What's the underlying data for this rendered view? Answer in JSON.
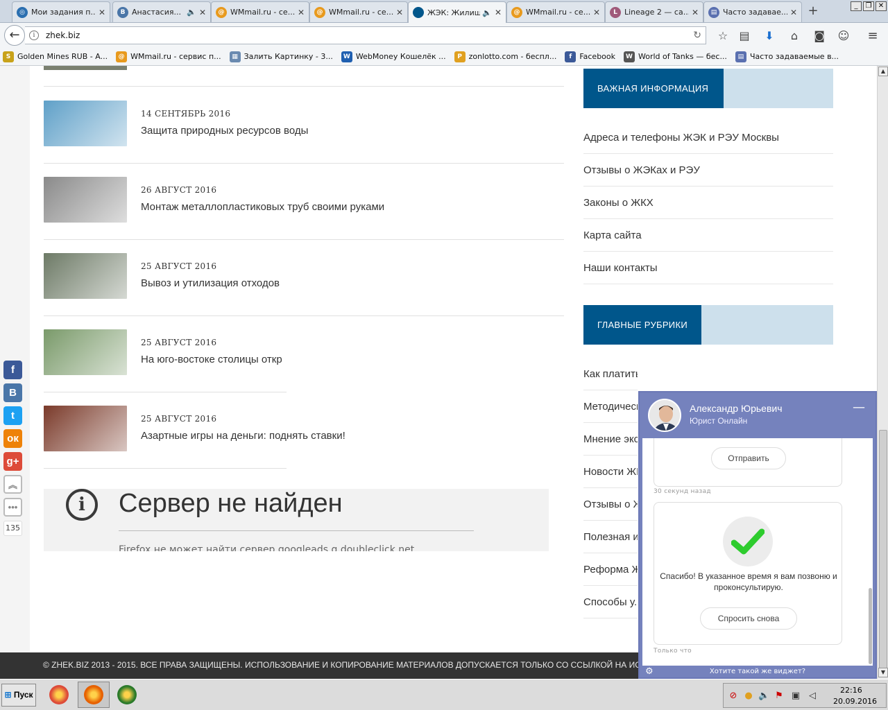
{
  "browser": {
    "tabs": [
      {
        "title": "Мои задания п...",
        "icon_color": "#2b6fb0",
        "icon_glyph": "◎"
      },
      {
        "title": "Анастасия...",
        "icon_color": "#4a76a8",
        "icon_glyph": "B",
        "sound": true
      },
      {
        "title": "WMmail.ru - се...",
        "icon_color": "#e89a1e",
        "icon_glyph": "@"
      },
      {
        "title": "WMmail.ru - се...",
        "icon_color": "#e89a1e",
        "icon_glyph": "@"
      },
      {
        "title": "ЖЭК: Жилищн...",
        "icon_color": "#00568b",
        "icon_glyph": "",
        "sound": true,
        "active": true
      },
      {
        "title": "WMmail.ru - се...",
        "icon_color": "#e89a1e",
        "icon_glyph": "@"
      },
      {
        "title": "Lineage 2 — са...",
        "icon_color": "#a05a7a",
        "icon_glyph": "L"
      },
      {
        "title": "Часто задавае...",
        "icon_color": "#5a70b0",
        "icon_glyph": "▤"
      }
    ],
    "url": "zhek.biz",
    "bookmarks": [
      {
        "label": "Golden Mines RUB - A...",
        "icon_color": "#c8a21a",
        "icon_glyph": "S"
      },
      {
        "label": "WMmail.ru - сервис п...",
        "icon_color": "#e89a1e",
        "icon_glyph": "@"
      },
      {
        "label": "Залить Картинку - 3...",
        "icon_color": "#6a8ab0",
        "icon_glyph": "▦"
      },
      {
        "label": "WebMoney Кошелёк ...",
        "icon_color": "#1f5fb0",
        "icon_glyph": "W"
      },
      {
        "label": "zonlotto.com - беспл...",
        "icon_color": "#e0a020",
        "icon_glyph": "P"
      },
      {
        "label": "Facebook",
        "icon_color": "#3b5998",
        "icon_glyph": "f"
      },
      {
        "label": "World of Tanks — бес...",
        "icon_color": "#555555",
        "icon_glyph": "W"
      },
      {
        "label": "Часто задаваемые в...",
        "icon_color": "#5a70b0",
        "icon_glyph": "▤"
      }
    ]
  },
  "articles": [
    {
      "date": "14 СЕНТЯБРЬ 2016",
      "title": "Защита природных ресурсов воды",
      "img_color": "#5fa0c8"
    },
    {
      "date": "26 АВГУСТ 2016",
      "title": "Монтаж металлопластиковых труб своими руками",
      "img_color": "#8a8a8a"
    },
    {
      "date": "25 АВГУСТ 2016",
      "title": "Вывоз и утилизация отходов",
      "img_color": "#6d7a66"
    },
    {
      "date": "25 АВГУСТ 2016",
      "title": "На юго-востоке столицы откр",
      "img_color": "#7a9a6a"
    },
    {
      "date": "25 АВГУСТ 2016",
      "title": "Азартные игры на деньги: поднять ставки!",
      "img_color": "#7a3a2a"
    }
  ],
  "error": {
    "title": "Сервер не найден",
    "message": "Firefox не может найти сервер googleads.g.doubleclick.net"
  },
  "sidebar": {
    "important_head": "ВАЖНАЯ ИНФОРМАЦИЯ",
    "important_links": [
      "Адреса и телефоны ЖЭК и РЭУ Москвы",
      "Отзывы о ЖЭКах и РЭУ",
      "Законы о ЖКХ",
      "Карта сайта",
      "Наши контакты"
    ],
    "rubrics_head": "ГЛАВНЫЕ РУБРИКИ",
    "rubric_links": [
      "Как платить меньше",
      "Методические...",
      "Мнение эксп...",
      "Новости ЖК...",
      "Отзывы о Ж...",
      "Полезная ин...",
      "Реформа ЖК...",
      "Способы у..."
    ]
  },
  "social": {
    "buttons": [
      {
        "name": "facebook",
        "glyph": "f",
        "color": "#3b5998"
      },
      {
        "name": "vkontakte",
        "glyph": "В",
        "color": "#4a76a8"
      },
      {
        "name": "twitter",
        "glyph": "t",
        "color": "#1da1f2"
      },
      {
        "name": "odnoklassniki",
        "glyph": "ок",
        "color": "#ee8208"
      },
      {
        "name": "google-plus",
        "glyph": "g+",
        "color": "#dd4b39"
      }
    ],
    "up_glyph": "︽",
    "more_glyph": "•••",
    "count": "135"
  },
  "footer": {
    "text": "© ZHEK.BIZ 2013 - 2015. ВСЕ ПРАВА ЗАЩИЩЕНЫ. ИСПОЛЬЗОВАНИЕ И КОПИРОВАНИЕ МАТЕРИАЛОВ ДОПУСКАЕТСЯ ТОЛЬКО СО ССЫЛКОЙ НА ИСТОЧНИК"
  },
  "chat": {
    "agent_name": "Александр Юрьевич",
    "agent_role": "Юрист Онлайн",
    "send_label": "Отправить",
    "ts1": "30 секунд назад",
    "thanks": "Спасибо! В указанное время я вам позвоню и проконсультирую.",
    "ask_again_label": "Спросить снова",
    "ts2": "Только что",
    "footer_link": "Хотите такой же виджет?"
  },
  "taskbar": {
    "start_label": "Пуск",
    "apps": [
      {
        "name": "chrome",
        "color": "#dd4b39"
      },
      {
        "name": "firefox",
        "color": "#e66000",
        "active": true
      },
      {
        "name": "kaspersky",
        "color": "#2a7a2a"
      }
    ],
    "clock_time": "22:16",
    "clock_date": "20.09.2016"
  },
  "colors": {
    "accent_blue": "#00568b",
    "accent_light": "#cde0ec",
    "chat_purple": "#7582bd",
    "footer_dark": "#333333",
    "check_green": "#2ecc2e"
  }
}
